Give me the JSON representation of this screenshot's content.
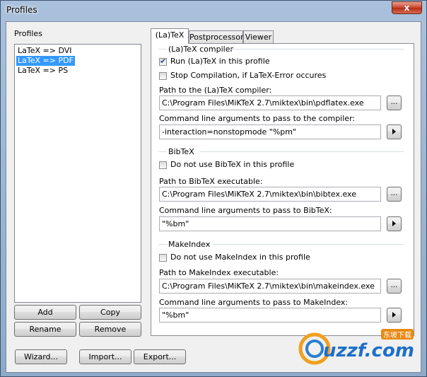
{
  "window": {
    "title": "Profiles",
    "close_glyph": "x"
  },
  "left": {
    "heading": "Profiles",
    "profiles": [
      "LaTeX => DVI",
      "LaTeX => PDF",
      "LaTeX => PS"
    ],
    "selected_index": 1,
    "buttons": {
      "add": "Add",
      "copy": "Copy",
      "rename": "Rename",
      "remove": "Remove"
    }
  },
  "bottom": {
    "wizard": "Wizard...",
    "import": "Import...",
    "export": "Export..."
  },
  "tabs": [
    "(La)TeX",
    "Postprocessor",
    "Viewer"
  ],
  "latex": {
    "group": "(La)TeX compiler",
    "run_label": "Run (La)TeX in this profile",
    "run_checked": true,
    "stop_label": "Stop Compilation, if LaTeX-Error occures",
    "stop_checked": false,
    "path_label": "Path to the (La)TeX compiler:",
    "path_value": "C:\\Program Files\\MiKTeX 2.7\\miktex\\bin\\pdflatex.exe",
    "args_label": "Command line arguments to pass to the compiler:",
    "args_value": "-interaction=nonstopmode \"%pm\""
  },
  "bibtex": {
    "group": "BibTeX",
    "disable_label": "Do not use BibTeX in this profile",
    "disable_checked": false,
    "path_label": "Path to BibTeX executable:",
    "path_value": "C:\\Program Files\\MiKTeX 2.7\\miktex\\bin\\bibtex.exe",
    "args_label": "Command line arguments to pass to BibTeX:",
    "args_value": "\"%bm\""
  },
  "makeindex": {
    "group": "MakeIndex",
    "disable_label": "Do not use MakeIndex in this profile",
    "disable_checked": false,
    "path_label": "Path to MakeIndex executable:",
    "path_value": "C:\\Program Files\\MiKTeX 2.7\\miktex\\bin\\makeindex.exe",
    "args_label": "Command line arguments to pass to MakeIndex:",
    "args_value": "\"%bm\""
  },
  "browse_label": "...",
  "watermark": {
    "text": "uzzf.com",
    "cn": "东坡下载"
  }
}
